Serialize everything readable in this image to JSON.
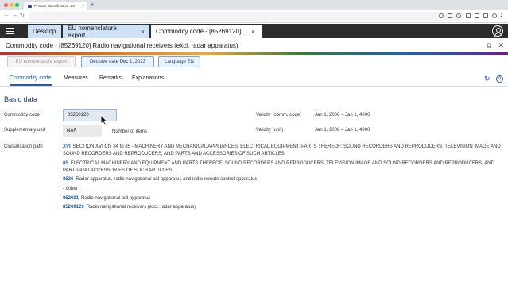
{
  "browser": {
    "tab_title": "Product Classification 4.0",
    "close_glyph": "×",
    "new_tab_glyph": "+",
    "back_glyph": "←",
    "forward_glyph": "→",
    "reload_glyph": "↻"
  },
  "app_tabs": [
    {
      "label": "Desktop",
      "closable": false
    },
    {
      "label": "EU nomenclature export",
      "closable": true,
      "close": "×"
    },
    {
      "label": "Commodity code - [85269120]...",
      "closable": true,
      "close": "×",
      "active": true
    }
  ],
  "page_title": "Commodity code - [85269120] Radio navigational receivers (excl. radar apparatus)",
  "title_icons": {
    "open_glyph": "⧉",
    "close_glyph": "✕"
  },
  "buttons": {
    "eu_export": "EU nomenclature export",
    "decisive_date": "Decisive date Dec 1, 2023",
    "language": "Language EN"
  },
  "subtabs": [
    "Commodity code",
    "Measures",
    "Remarks",
    "Explanations"
  ],
  "help_glyph": "?",
  "refresh_glyph": "↻",
  "section_title": "Basic data",
  "fields": {
    "commodity_code_label": "Commodity code",
    "commodity_code_value": "85269120",
    "supplementary_unit_label": "Supplementary unit",
    "supplementary_unit_value": "NAR",
    "supplementary_unit_desc": "Number of items",
    "classification_path_label": "Classification path",
    "validity_comm_label": "Validity (comm. code)",
    "validity_comm_value": "Jan 1, 2006 – Jan 1, 4000",
    "validity_unit_label": "Validity (unit)",
    "validity_unit_value": "Jan 1, 2008 – Jan 1, 4000"
  },
  "classification_path": [
    {
      "code": "XVI",
      "text": "SECTION XVI Ch. 84 to 85 - MACHINERY AND MECHANICAL APPLIANCES; ELECTRICAL EQUIPMENT; PARTS THEREOF; SOUND RECORDERS AND REPRODUCERS, TELEVISION IMAGE AND SOUND RECORDERS AND REPRODUCERS, AND PARTS AND ACCESSORIES OF SUCH ARTICLES"
    },
    {
      "code": "85",
      "text": "ELECTRICAL MACHINERY AND EQUIPMENT AND PARTS THEREOF; SOUND RECORDERS AND REPRODUCERS, TELEVISION IMAGE AND SOUND RECORDERS AND REPRODUCERS, AND PARTS AND ACCESSORIES OF SUCH ARTICLES"
    },
    {
      "code": "8526",
      "text": "Radar apparatus, radio navigational aid apparatus and radio remote control apparatus"
    },
    {
      "code": "",
      "text": "- Other"
    },
    {
      "code": "852691",
      "text": "Radio navigational aid apparatus"
    },
    {
      "code": "85269120",
      "text": "Radio navigational receivers (excl. radar apparatus)"
    }
  ],
  "colors": {
    "app_header": "#2d2d2d",
    "tab_inactive": "#cfe1f5",
    "link_blue": "#1f5aa6"
  }
}
